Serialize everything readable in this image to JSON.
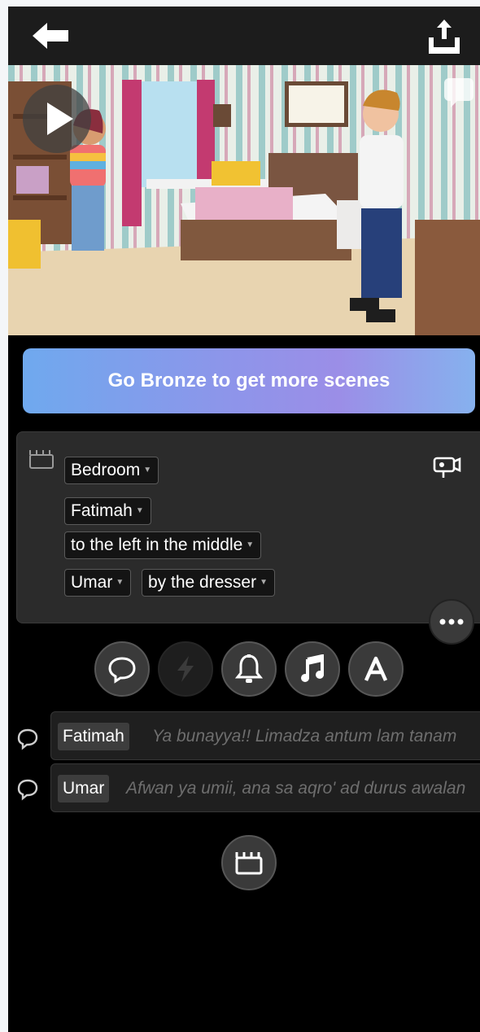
{
  "promo": {
    "label": "Go Bronze to get more scenes"
  },
  "scene": {
    "location": "Bedroom",
    "character1": "Fatimah",
    "character1_position": "to the left in the middle",
    "character2": "Umar",
    "character2_position": "by the dresser"
  },
  "dialogue": [
    {
      "speaker": "Fatimah",
      "text": "Ya bunayya!! Limadza antum lam tanam"
    },
    {
      "speaker": "Umar",
      "text": "Afwan ya umii, ana sa aqro' ad durus awalan"
    }
  ],
  "toolbar": [
    "speech-bubble-icon",
    "lightning-icon",
    "bell-icon",
    "music-note-icon",
    "text-a-icon"
  ],
  "colors": {
    "background": "#000000",
    "panel": "#2b2b2b",
    "button": "#3a3a3a",
    "promo_start": "#6fa9ee",
    "promo_end": "#9b8ee7"
  }
}
